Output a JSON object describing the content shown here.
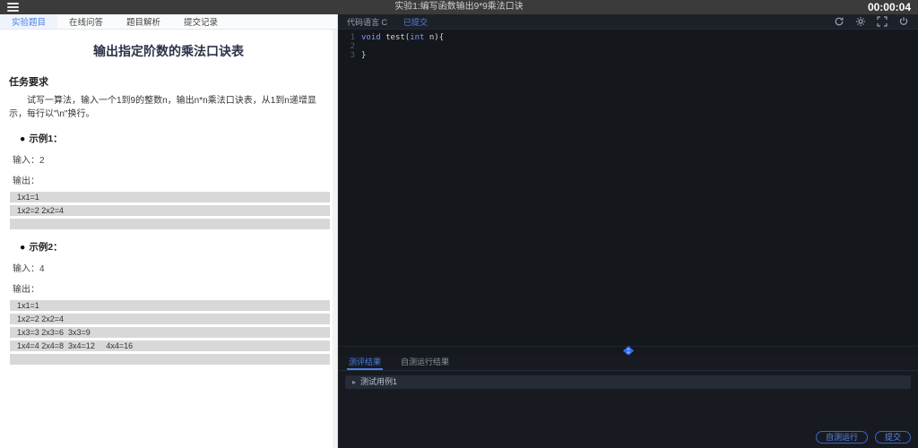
{
  "colors": {
    "accent": "#4a7fe0",
    "keyword": "#7a9ff7",
    "topbar_bg": "#3b3b3b",
    "sample_row_bg": "#d8d8d8"
  },
  "topbar": {
    "title": "实验1:编写函数输出9*9乘法口诀",
    "timer": "00:00:04"
  },
  "left_panel": {
    "tabs": [
      {
        "label": "实验题目",
        "active": true
      },
      {
        "label": "在线问答",
        "active": false
      },
      {
        "label": "题目解析",
        "active": false
      },
      {
        "label": "提交记录",
        "active": false
      }
    ],
    "problem_title": "输出指定阶数的乘法口诀表",
    "requirement_heading": "任务要求",
    "requirement_text": "试写一算法，输入一个1到9的整数n，输出n*n乘法口诀表，从1到n递增显示，每行以\"\\n\"换行。",
    "examples": [
      {
        "heading": "示例1：",
        "input": "输入：2",
        "output_label": "输出：",
        "rows": [
          "1x1=1",
          "1x2=2 2x2=4",
          ""
        ]
      },
      {
        "heading": "示例2：",
        "input": "输入：4",
        "output_label": "输出：",
        "rows": [
          "1x1=1",
          "1x2=2 2x2=4",
          "1x3=3 2x3=6  3x3=9",
          "1x4=4 2x4=8  3x4=12     4x4=16",
          ""
        ]
      }
    ]
  },
  "editor": {
    "language_label": "代码语言 C",
    "submitted_tab": "已提交",
    "toolbar_icons": [
      "refresh-icon",
      "settings-icon",
      "fullscreen-icon",
      "power-icon"
    ],
    "line_numbers": [
      "1",
      "2",
      "3"
    ],
    "code": {
      "kw1": "void",
      "mid": " test(",
      "kw2": "int",
      "tail": " n){",
      "close": "}"
    }
  },
  "results": {
    "tabs": [
      {
        "label": "测评结果",
        "active": true
      },
      {
        "label": "自测运行结果",
        "active": false
      }
    ],
    "testcase_arrow": "▸",
    "testcase_label": "测试用例1",
    "run_button": "自测运行",
    "submit_button": "提交"
  }
}
